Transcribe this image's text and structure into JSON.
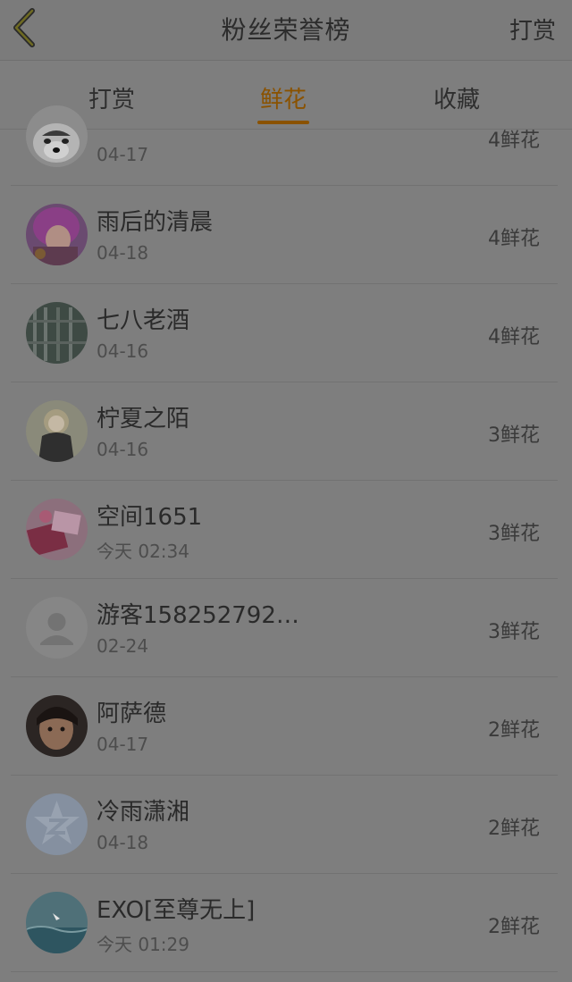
{
  "header": {
    "title": "粉丝荣誉榜",
    "action_label": "打赏"
  },
  "tabs": [
    {
      "label": "打赏",
      "active": false
    },
    {
      "label": "鲜花",
      "active": true
    },
    {
      "label": "收藏",
      "active": false
    }
  ],
  "colors": {
    "accent": "#8a5200",
    "background": "#7e7e7e"
  },
  "list": [
    {
      "name": "",
      "date": "04-17",
      "count": "4鲜花",
      "avatar": "husky-dog-avatar"
    },
    {
      "name": "雨后的清晨",
      "date": "04-18",
      "count": "4鲜花",
      "avatar": "anime-pink-hair-avatar"
    },
    {
      "name": "七八老酒",
      "date": "04-16",
      "count": "4鲜花",
      "avatar": "window-photo-avatar"
    },
    {
      "name": "柠夏之陌",
      "date": "04-16",
      "count": "3鲜花",
      "avatar": "anime-girl-avatar"
    },
    {
      "name": "空间1651",
      "date": "今天 02:34",
      "count": "3鲜花",
      "avatar": "pink-objects-avatar"
    },
    {
      "name": "游客158252792…",
      "date": "02-24",
      "count": "3鲜花",
      "avatar": "default-user-avatar"
    },
    {
      "name": "阿萨德",
      "date": "04-17",
      "count": "2鲜花",
      "avatar": "child-photo-avatar"
    },
    {
      "name": "冷雨潇湘",
      "date": "04-18",
      "count": "2鲜花",
      "avatar": "qzone-logo-avatar"
    },
    {
      "name": "EXO[至尊无上]",
      "date": "今天 01:29",
      "count": "2鲜花",
      "avatar": "sea-photo-avatar"
    }
  ]
}
